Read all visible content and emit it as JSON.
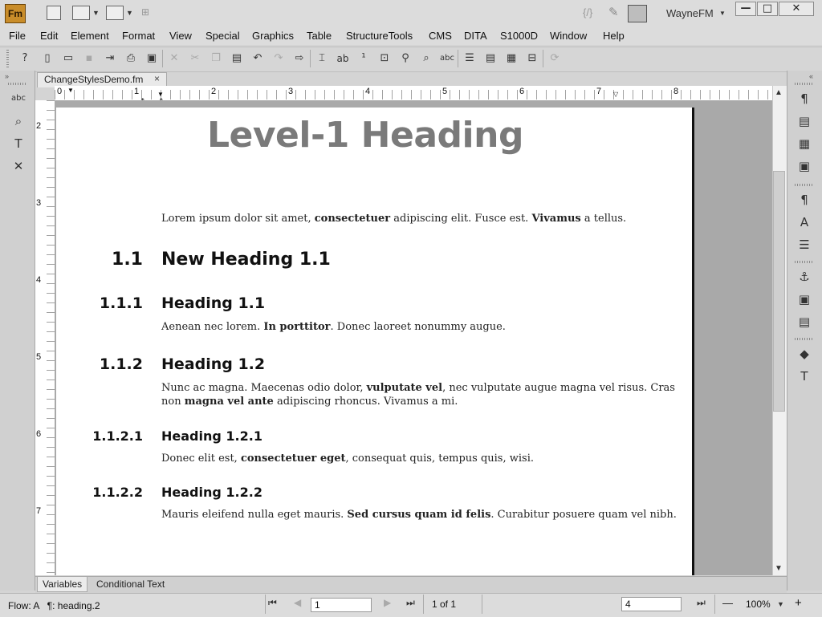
{
  "titlebar": {
    "logo": "Fm",
    "user": "WayneFM",
    "min": "—",
    "max": "□",
    "close": "✕"
  },
  "menubar": [
    "File",
    "Edit",
    "Element",
    "Format",
    "View",
    "Special",
    "Graphics",
    "Table",
    "StructureTools",
    "CMS",
    "DITA",
    "S1000D",
    "Window",
    "Help"
  ],
  "document": {
    "tab_label": "ChangeStylesDemo.fm",
    "tab_close": "×",
    "ruler_h": [
      "0",
      "1",
      "2",
      "3",
      "4",
      "5",
      "6",
      "7",
      "8"
    ],
    "ruler_v": [
      "2",
      "3",
      "4",
      "5",
      "6",
      "7"
    ],
    "title": "Level-1 Heading",
    "para0": {
      "a": "Lorem ipsum dolor sit amet, ",
      "b": "consectetuer",
      "c": " adipiscing elit. Fusce est. ",
      "d": "Vivamus",
      "e": " a tellus."
    },
    "headings": [
      {
        "num": "1.1",
        "text": "New Heading 1.1"
      },
      {
        "num": "1.1.1",
        "text": "Heading 1.1"
      },
      {
        "num": "1.1.2",
        "text": "Heading 1.2"
      },
      {
        "num": "1.1.2.1",
        "text": "Heading 1.2.1"
      },
      {
        "num": "1.1.2.2",
        "text": "Heading 1.2.2"
      }
    ],
    "para1": {
      "a": "Aenean nec lorem. ",
      "b": "In porttitor",
      "c": ". Donec laoreet nonummy augue."
    },
    "para2": {
      "a": "Nunc ac magna. Maecenas odio dolor, ",
      "b": "vulputate vel",
      "c": ", nec vulputate augue magna vel risus. Cras",
      "d": "non ",
      "e": "magna vel ante",
      "f": " adipiscing rhoncus. Vivamus a mi."
    },
    "para3": {
      "a": "Donec elit est, ",
      "b": "consectetuer eget",
      "c": ", consequat quis, tempus quis, wisi."
    },
    "para4": {
      "a": "Mauris eleifend nulla eget mauris. ",
      "b": "Sed cursus quam id felis",
      "c": ". Curabitur posuere quam vel nibh."
    }
  },
  "bottom_tabs": [
    "Variables",
    "Conditional Text"
  ],
  "status": {
    "flow": "Flow: A   ¶: heading.2",
    "page_input": "1",
    "page_of": "1 of 1",
    "zoom_input": "4",
    "zoom_label": "100%",
    "zoom_minus": "—",
    "zoom_plus": "+"
  }
}
